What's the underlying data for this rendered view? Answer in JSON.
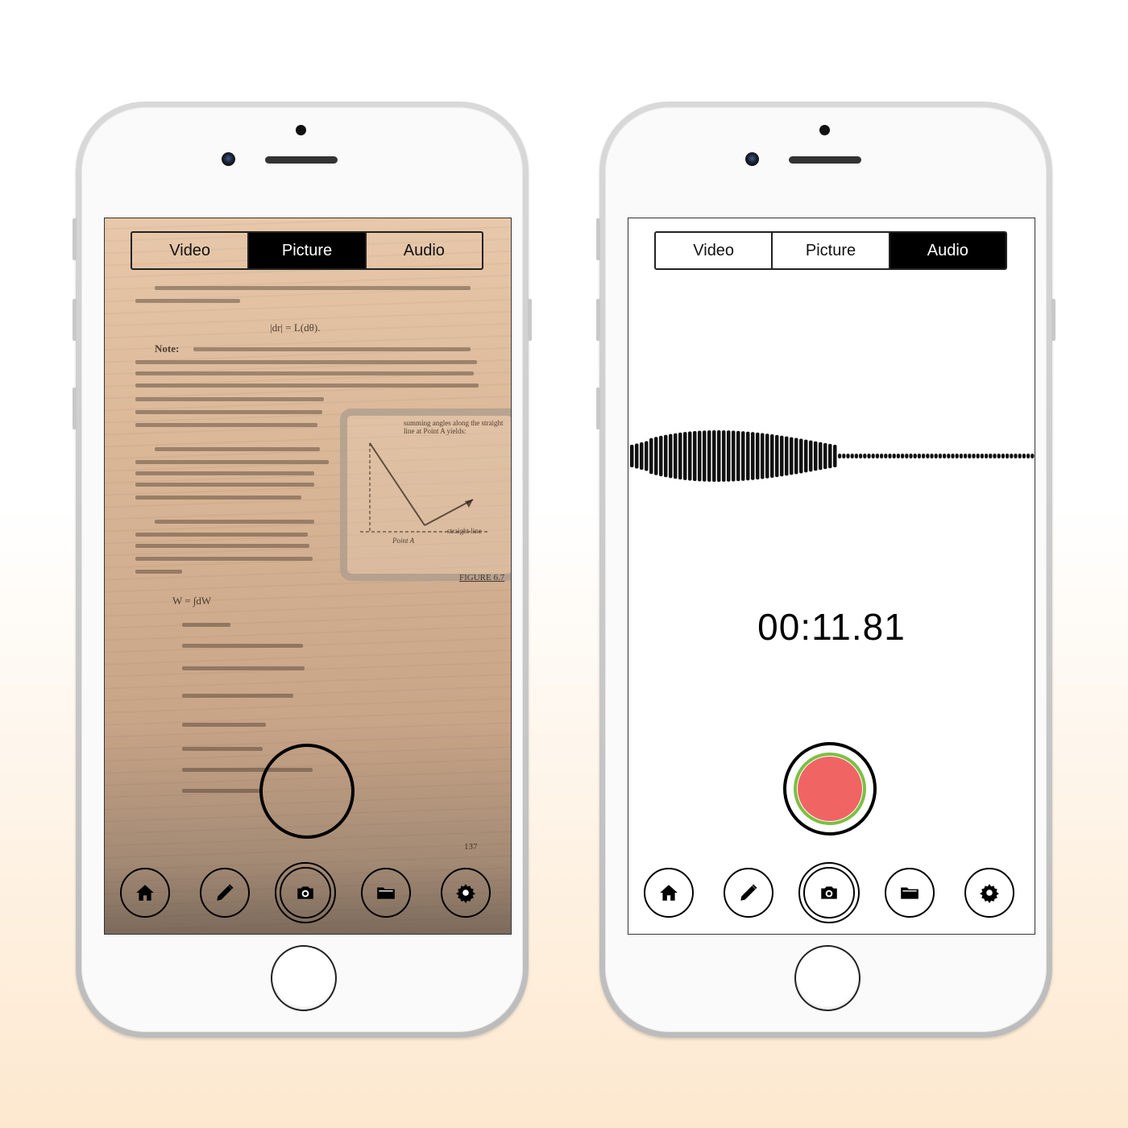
{
  "phones": [
    {
      "tabs": [
        {
          "label": "Video",
          "active": false
        },
        {
          "label": "Picture",
          "active": true
        },
        {
          "label": "Audio",
          "active": false
        }
      ],
      "document": {
        "formula_line": "|dr| = L(dθ).",
        "note_heading": "Note:",
        "figure_caption": "summing angles along the straight line at Point A yields:",
        "figure_label": "FIGURE 6.7",
        "point_label": "Point A",
        "straight_line_label": "straight line",
        "work_eq": "W = ∫dW",
        "page_number": "137"
      },
      "toolbar": [
        {
          "icon": "home-icon"
        },
        {
          "icon": "pencil-icon"
        },
        {
          "icon": "camera-icon"
        },
        {
          "icon": "folder-icon"
        },
        {
          "icon": "gear-icon"
        }
      ]
    },
    {
      "tabs": [
        {
          "label": "Video",
          "active": false
        },
        {
          "label": "Picture",
          "active": false
        },
        {
          "label": "Audio",
          "active": true
        }
      ],
      "timer": "00:11.81",
      "record_color": "#f06464",
      "record_ring_color": "#7bc043",
      "toolbar": [
        {
          "icon": "home-icon"
        },
        {
          "icon": "pencil-icon"
        },
        {
          "icon": "camera-icon"
        },
        {
          "icon": "folder-icon"
        },
        {
          "icon": "gear-icon"
        }
      ]
    }
  ]
}
